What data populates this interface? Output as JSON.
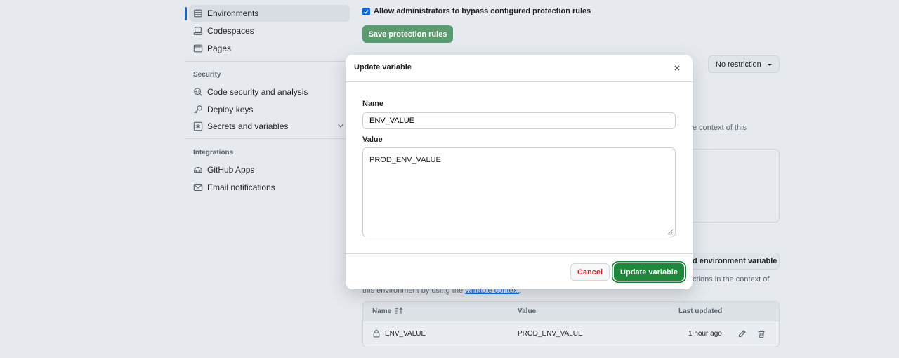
{
  "sidebar": {
    "items_top": [
      {
        "label": "Environments",
        "icon": "server-icon"
      },
      {
        "label": "Codespaces",
        "icon": "codespaces-icon"
      },
      {
        "label": "Pages",
        "icon": "browser-icon"
      }
    ],
    "security_heading": "Security",
    "security_items": [
      {
        "label": "Code security and analysis",
        "icon": "codescan-icon"
      },
      {
        "label": "Deploy keys",
        "icon": "key-icon"
      },
      {
        "label": "Secrets and variables",
        "icon": "asterisk-icon"
      }
    ],
    "integrations_heading": "Integrations",
    "integration_items": [
      {
        "label": "GitHub Apps",
        "icon": "apps-icon"
      },
      {
        "label": "Email notifications",
        "icon": "mail-icon"
      }
    ]
  },
  "main": {
    "bypass_checkbox_label": "Allow administrators to bypass configured protection rules",
    "bypass_checked": true,
    "save_rules_label": "Save protection rules",
    "restriction_select": "No restriction",
    "partial_text_right": "e context of this",
    "add_env_var_label": "d environment variable",
    "vars_desc_line1_right": "ctions in the context of",
    "vars_desc_line2_prefix": "this environment by using the ",
    "vars_desc_link": "variable context",
    "vars_desc_line2_suffix": "."
  },
  "table": {
    "headers": {
      "name": "Name",
      "value": "Value",
      "updated": "Last updated"
    },
    "rows": [
      {
        "name": "ENV_VALUE",
        "value": "PROD_ENV_VALUE",
        "updated": "1 hour ago"
      }
    ]
  },
  "modal": {
    "title": "Update variable",
    "name_label": "Name",
    "name_value": "ENV_VALUE",
    "value_label": "Value",
    "value_value": "PROD_ENV_VALUE",
    "cancel_label": "Cancel",
    "submit_label": "Update variable"
  },
  "colors": {
    "primary_green": "#1f883d",
    "danger_red": "#cf222e",
    "accent_blue": "#0969da"
  }
}
